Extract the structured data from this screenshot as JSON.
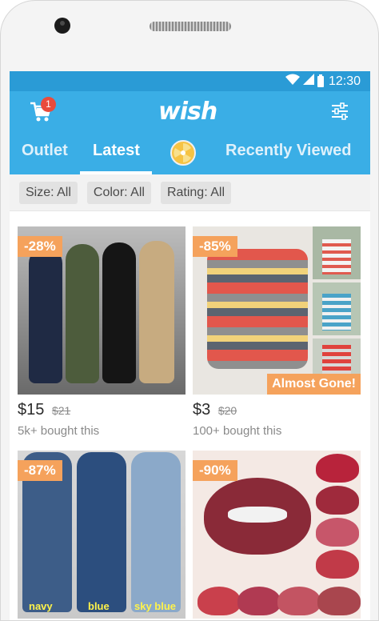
{
  "status_bar": {
    "time": "12:30"
  },
  "app_bar": {
    "cart_badge": "1",
    "logo_text": "wish"
  },
  "tabs": [
    {
      "label": "Outlet"
    },
    {
      "label": "Latest"
    },
    {
      "label": "Recently Viewed"
    }
  ],
  "filters": [
    {
      "label": "Size: All"
    },
    {
      "label": "Color: All"
    },
    {
      "label": "Rating: All"
    }
  ],
  "products": [
    {
      "discount": "-28%",
      "price": "$15",
      "old_price": "$21",
      "bought": "5k+ bought this"
    },
    {
      "discount": "-85%",
      "price": "$3",
      "old_price": "$20",
      "bought": "100+ bought this",
      "badge": "Almost Gone!"
    },
    {
      "discount": "-87%",
      "image_labels": [
        "navy",
        "blue",
        "sky blue"
      ]
    },
    {
      "discount": "-90%"
    }
  ],
  "colors": {
    "brand": "#3aaee6",
    "status_bar": "#2a9bd6",
    "discount": "#f5a25c",
    "badge": "#e94b3c"
  }
}
